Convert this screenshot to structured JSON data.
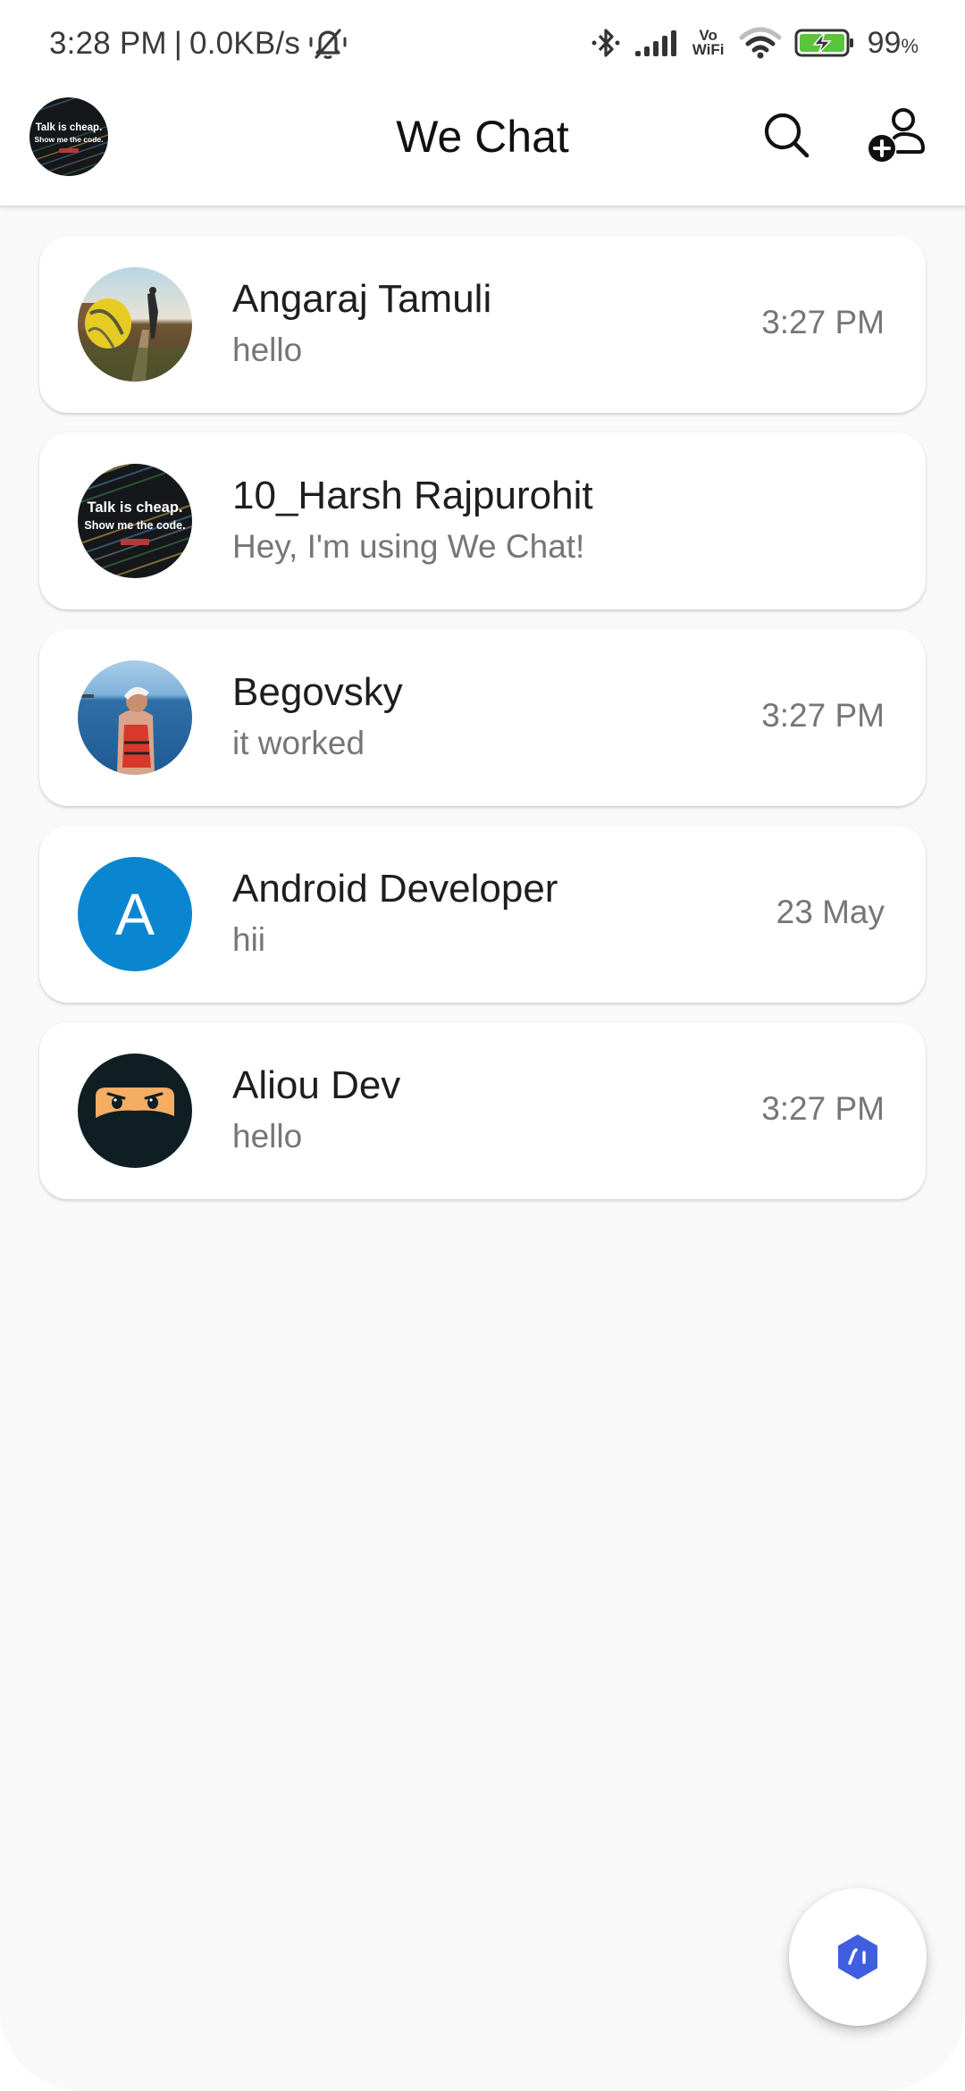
{
  "status_bar": {
    "time": "3:28 PM",
    "separator": "|",
    "network_speed": "0.0KB/s",
    "icons": [
      "bell-muted-icon",
      "bluetooth-icon",
      "signal-icon",
      "vowifi-icon",
      "wifi-icon",
      "battery-charging-icon"
    ],
    "vowifi_top": "Vo",
    "vowifi_bottom": "WiFi",
    "battery_percent": "99",
    "battery_suffix": "%",
    "battery_color": "#5ac43a"
  },
  "app_bar": {
    "title": "We Chat",
    "profile_avatar_text_line1": "Talk is cheap.",
    "profile_avatar_text_line2": "Show me the code.",
    "actions": [
      {
        "name": "search",
        "icon": "search-icon"
      },
      {
        "name": "add-user",
        "icon": "add-user-icon"
      }
    ]
  },
  "chats": [
    {
      "name": "Angaraj Tamuli",
      "last_message": "hello",
      "time": "3:27 PM",
      "avatar": "photo-tennis-ball"
    },
    {
      "name": "10_Harsh Rajpurohit",
      "last_message": "Hey, I'm using We Chat!",
      "time": "",
      "avatar": "photo-talk-is-cheap",
      "avatar_text_line1": "Talk is cheap.",
      "avatar_text_line2": "Show me the code."
    },
    {
      "name": "Begovsky",
      "last_message": "it worked",
      "time": "3:27 PM",
      "avatar": "photo-sea-kayak"
    },
    {
      "name": "Android Developer",
      "last_message": "hii",
      "time": "23 May",
      "avatar": "letter",
      "avatar_letter": "A",
      "avatar_color": "#0a86d0"
    },
    {
      "name": "Aliou Dev",
      "last_message": "hello",
      "time": "3:27 PM",
      "avatar": "ninja-illustration"
    }
  ],
  "fab": {
    "icon": "ai-assistant-hexagon-icon",
    "icon_color": "#3f5fe0"
  },
  "colors": {
    "background": "#f9f9f9",
    "card": "#ffffff",
    "primary_text": "#1e1e1e",
    "secondary_text": "#767676"
  }
}
